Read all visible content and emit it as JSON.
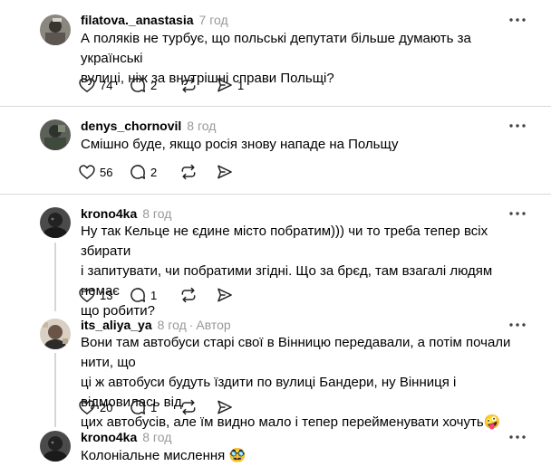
{
  "posts": [
    {
      "username": "filatova._anastasia",
      "time": "7 год",
      "text_lines": [
        "А поляків не турбує, що польські депутати більше думають за українські",
        "вулиці, ніж за внутрішні справи Польщі?"
      ],
      "likes": "74",
      "replies": "2",
      "shares": "1"
    },
    {
      "username": "denys_chornovil",
      "time": "8 год",
      "text_lines": [
        "Смішно буде, якщо росія знову нападе на Польщу"
      ],
      "likes": "56",
      "replies": "2"
    },
    {
      "username": "krono4ka",
      "time": "8 год",
      "text_lines": [
        "Ну так Кельце не єдине місто побратим))) чи то треба тепер всіх збирати",
        "і запитувати, чи побратими згідні. Що за брєд, там взагалі людям немає",
        "що робити?"
      ],
      "likes": "13",
      "replies": "1"
    },
    {
      "username": "its_aliya_ya",
      "time": "8 год",
      "separator": "·",
      "role": "Автор",
      "text_lines": [
        "Вони там автобуси старі свої в Вінницю передавали, а потім почали нити, що",
        "ці ж автобуси будуть їздити по вулиці Бандери, ну Вінниця і відмовилась від",
        "цих автобусів, але їм видно мало і тепер перейменувати хочуть🤪"
      ],
      "likes": "20",
      "replies": "1"
    },
    {
      "username": "krono4ka",
      "time": "8 год",
      "text_lines": [
        "Колоніальне мислення 🥸"
      ]
    }
  ],
  "icons": {
    "like": "heart-icon",
    "reply": "comment-icon",
    "repost": "repost-icon",
    "share": "send-icon",
    "more": "more-dots-icon"
  },
  "colors": {
    "muted": "#999999",
    "divider": "#d9d9d9",
    "thread_line": "#d6d6d6"
  }
}
